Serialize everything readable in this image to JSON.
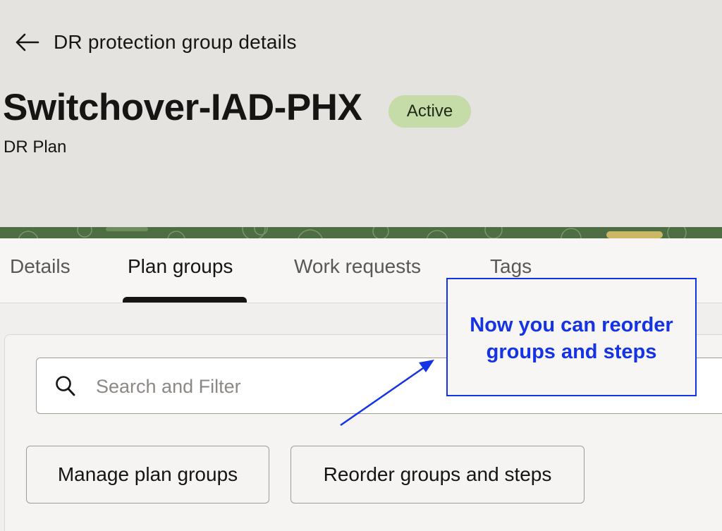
{
  "header": {
    "back_label": "DR protection group details",
    "title": "Switchover-IAD-PHX",
    "status": "Active",
    "subtitle": "DR Plan"
  },
  "tabs": [
    {
      "label": "Details",
      "active": false
    },
    {
      "label": "Plan groups",
      "active": true
    },
    {
      "label": "Work requests",
      "active": false
    },
    {
      "label": "Tags",
      "active": false
    }
  ],
  "search": {
    "placeholder": "Search and Filter",
    "value": ""
  },
  "actions": {
    "manage_label": "Manage plan groups",
    "reorder_label": "Reorder groups and steps"
  },
  "annotation": {
    "text_line1": "Now you can reorder",
    "text_line2": "groups and steps"
  },
  "icons": {
    "back": "arrow-left-icon",
    "search": "search-icon"
  },
  "colors": {
    "header_bg": "#e5e3e0",
    "status_badge_bg": "#c5dba8",
    "annotation": "#1433e6",
    "band": "#4d6d42"
  }
}
